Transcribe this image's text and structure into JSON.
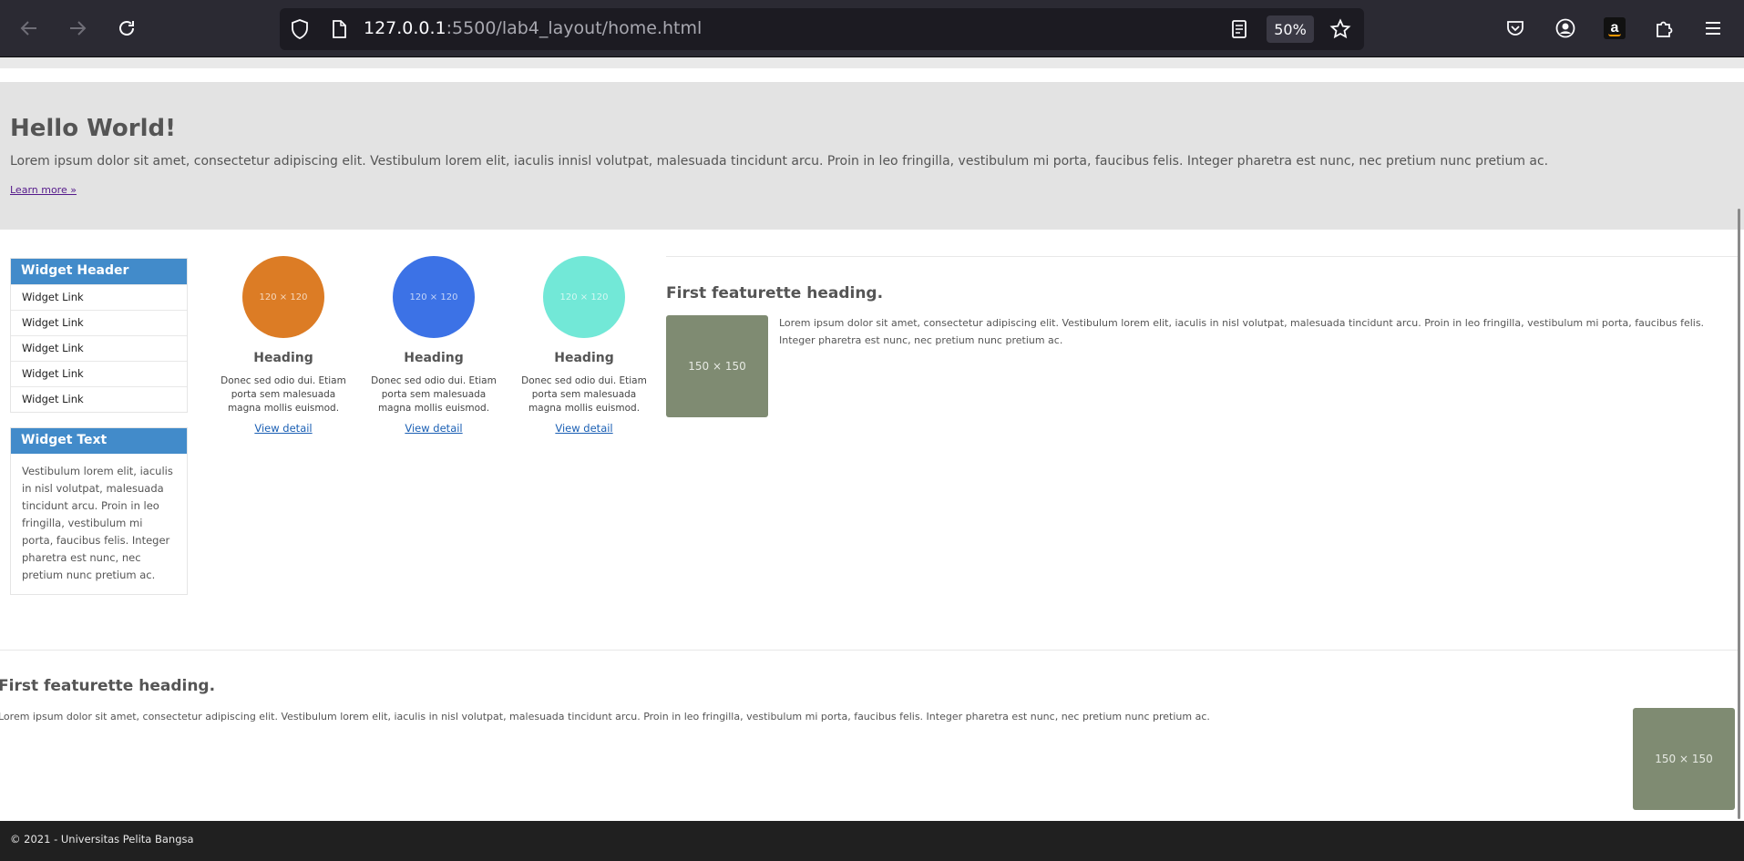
{
  "browser": {
    "url_host": "127.0.0.1",
    "url_path": ":5500/lab4_layout/home.html",
    "zoom": "50%"
  },
  "jumbotron": {
    "title": "Hello World!",
    "text": "Lorem ipsum dolor sit amet, consectetur adipiscing elit. Vestibulum lorem elit, iaculis innisl volutpat, malesuada tincidunt arcu. Proin in leo fringilla, vestibulum mi porta, faucibus felis. Integer pharetra est nunc, nec pretium nunc pretium ac.",
    "link": "Learn more »"
  },
  "sidebar": {
    "widget_header": "Widget Header",
    "links": [
      "Widget Link",
      "Widget Link",
      "Widget Link",
      "Widget Link",
      "Widget Link"
    ],
    "widget_text_title": "Widget Text",
    "widget_text": "Vestibulum lorem elit, iaculis in nisl volutpat, malesuada tincidunt arcu. Proin in leo fringilla, vestibulum mi porta, faucibus felis. Integer pharetra est nunc, nec pretium nunc pretium ac."
  },
  "cards": [
    {
      "placeholder": "120 × 120",
      "heading": "Heading",
      "text": "Donec sed odio dui. Etiam porta sem malesuada magna mollis euismod.",
      "link": "View detail",
      "color": "#dc7c25"
    },
    {
      "placeholder": "120 × 120",
      "heading": "Heading",
      "text": "Donec sed odio dui. Etiam porta sem malesuada magna mollis euismod.",
      "link": "View detail",
      "color": "#3c72e6"
    },
    {
      "placeholder": "120 × 120",
      "heading": "Heading",
      "text": "Donec sed odio dui. Etiam porta sem malesuada magna mollis euismod.",
      "link": "View detail",
      "color": "#72e8d7"
    }
  ],
  "featurette1": {
    "heading": "First featurette heading.",
    "text": "Lorem ipsum dolor sit amet, consectetur adipiscing elit. Vestibulum lorem elit, iaculis in nisl volutpat, malesuada tincidunt arcu. Proin in leo fringilla, vestibulum mi porta, faucibus felis. Integer pharetra est nunc, nec pretium nunc pretium ac.",
    "image": "150 × 150"
  },
  "featurette2": {
    "heading": "First featurette heading.",
    "text": "Lorem ipsum dolor sit amet, consectetur adipiscing elit. Vestibulum lorem elit, iaculis in nisl volutpat, malesuada tincidunt arcu. Proin in leo fringilla, vestibulum mi porta, faucibus felis. Integer pharetra est nunc, nec pretium nunc pretium ac.",
    "image": "150 × 150"
  },
  "footer": {
    "text": "© 2021 - Universitas Pelita Bangsa"
  },
  "colors": {
    "widget_header_bg": "#428bca",
    "placeholder_bg": "#7f8b72",
    "footer_bg": "#202020"
  }
}
